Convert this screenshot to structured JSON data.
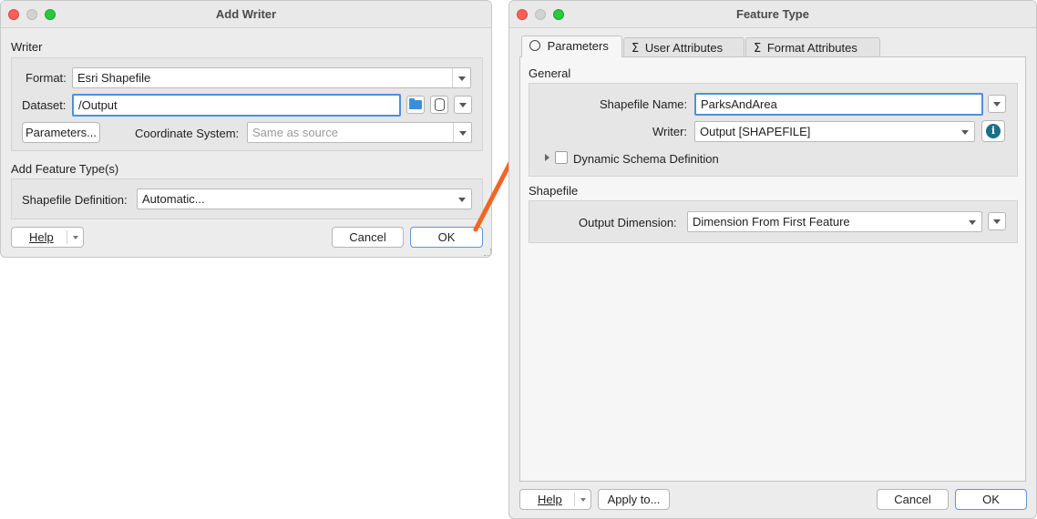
{
  "add_writer": {
    "title": "Add Writer",
    "writer_section": "Writer",
    "format_label": "Format:",
    "format_value": "Esri Shapefile",
    "dataset_label": "Dataset:",
    "dataset_value": "/Output",
    "parameters_button": "Parameters...",
    "coord_label": "Coordinate System:",
    "coord_placeholder": "Same as source",
    "feature_type_section": "Add Feature Type(s)",
    "shapefile_def_label": "Shapefile Definition:",
    "shapefile_def_value": "Automatic...",
    "help_button": "Help",
    "cancel_button": "Cancel",
    "ok_button": "OK"
  },
  "feature_type": {
    "title": "Feature Type",
    "tabs": [
      {
        "label": "Parameters",
        "icon": "gear-icon"
      },
      {
        "label": "User Attributes",
        "icon": "sigma-icon"
      },
      {
        "label": "Format Attributes",
        "icon": "sigma-icon"
      }
    ],
    "general_section": "General",
    "shapefile_name_label": "Shapefile Name:",
    "shapefile_name_value": "ParksAndArea",
    "writer_label": "Writer:",
    "writer_value": "Output [SHAPEFILE]",
    "info_glyph": "i",
    "dynamic_schema_label": "Dynamic Schema Definition",
    "shapefile_section": "Shapefile",
    "output_dimension_label": "Output Dimension:",
    "output_dimension_value": "Dimension From First Feature",
    "help_button": "Help",
    "apply_to_button": "Apply to...",
    "cancel_button": "Cancel",
    "ok_button": "OK"
  },
  "colors": {
    "arrow": "#f26522",
    "focus_ring": "#4f8fd8",
    "info_icon": "#1a6f88"
  }
}
